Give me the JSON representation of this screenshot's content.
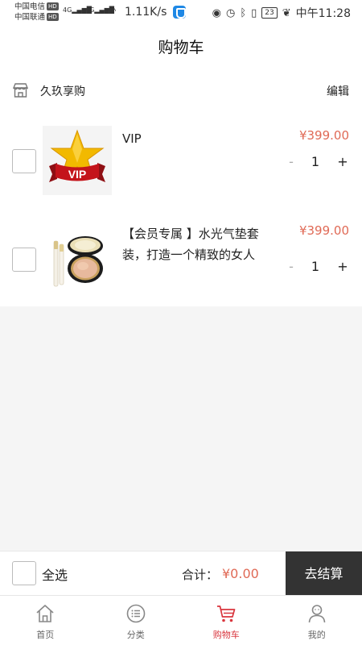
{
  "status": {
    "carrier1": "中国电信",
    "carrier2": "中国联通",
    "hd": "HD",
    "net": "4G",
    "speed": "1.11K/s",
    "battery": "23",
    "time": "中午11:28"
  },
  "header": {
    "title": "购物车"
  },
  "shop": {
    "name": "久玖享购",
    "edit_label": "编辑"
  },
  "items": [
    {
      "title": "VIP",
      "price": "¥399.00",
      "minus": "-",
      "qty": "1",
      "plus": "+",
      "badge_text": "VIP"
    },
    {
      "title": "【会员专属 】水光气垫套装，打造一个精致的女人",
      "price": "¥399.00",
      "minus": "-",
      "qty": "1",
      "plus": "+"
    }
  ],
  "checkout": {
    "select_all": "全选",
    "total_label": "合计：",
    "total_amount": "¥0.00",
    "button": "去结算"
  },
  "tabs": [
    {
      "label": "首页",
      "icon": "home-icon"
    },
    {
      "label": "分类",
      "icon": "list-icon"
    },
    {
      "label": "购物车",
      "icon": "cart-icon"
    },
    {
      "label": "我的",
      "icon": "user-icon"
    }
  ],
  "colors": {
    "price": "#e06a56",
    "active_tab": "#d9363e",
    "checkout_button": "#333333"
  }
}
